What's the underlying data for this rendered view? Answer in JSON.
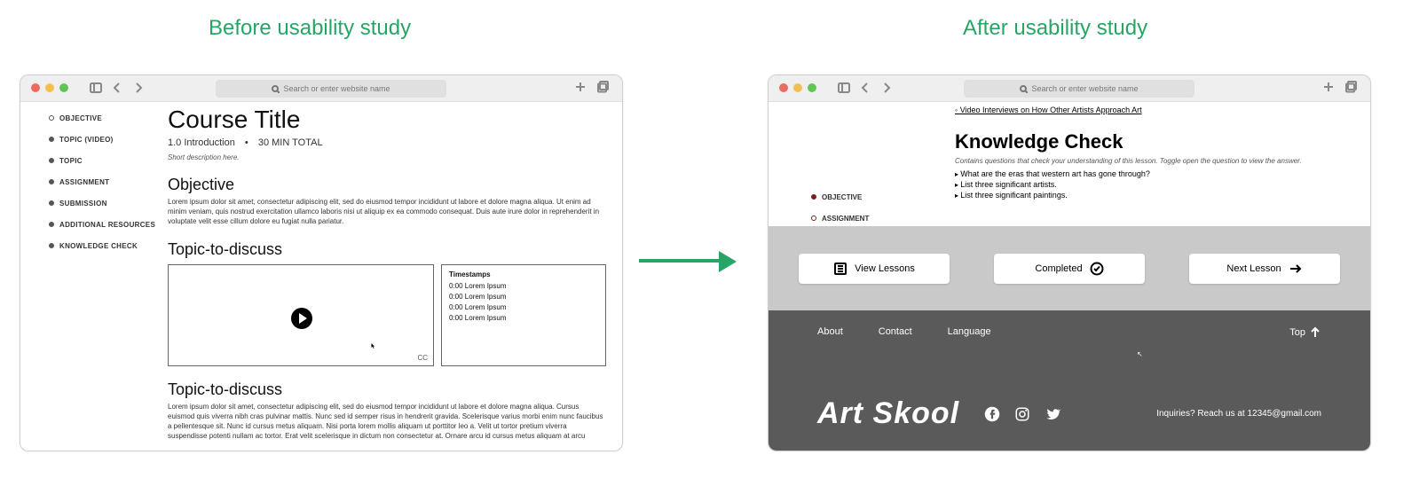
{
  "headings": {
    "before": "Before usability study",
    "after": "After usability study"
  },
  "chrome": {
    "url_placeholder": "Search or enter website name"
  },
  "left": {
    "nav": [
      "OBJECTIVE",
      "TOPIC (VIDEO)",
      "TOPIC",
      "ASSIGNMENT",
      "SUBMISSION",
      "ADDITIONAL RESOURCES",
      "KNOWLEDGE CHECK"
    ],
    "title": "Course Title",
    "meta_left": "1.0 Introduction",
    "meta_right": "30 MIN TOTAL",
    "short": "Short description here.",
    "objective_h": "Objective",
    "objective_p": "Lorem ipsum dolor sit amet, consectetur adipiscing elit, sed do eiusmod tempor incididunt ut labore et dolore magna aliqua. Ut enim ad minim veniam, quis nostrud exercitation ullamco laboris nisi ut aliquip ex ea commodo consequat. Duis aute irure dolor in reprehenderit in voluptate velit esse cillum dolore eu fugiat nulla pariatur.",
    "topic_h": "Topic-to-discuss",
    "cc": "CC",
    "ts_head": "Timestamps",
    "ts_rows": [
      "0:00   Lorem Ipsum",
      "0:00   Lorem Ipsum",
      "0:00   Lorem Ipsum",
      "0:00   Lorem Ipsum"
    ],
    "topic2_h": "Topic-to-discuss",
    "topic2_p": "Lorem ipsum dolor sit amet, consectetur adipiscing elit, sed do eiusmod tempor incididunt ut labore et dolore magna aliqua. Cursus euismod quis viverra nibh cras pulvinar mattis. Nunc sed id semper risus in hendrerit gravida. Scelerisque varius morbi enim nunc faucibus a pellentesque sit. Nunc id cursus metus aliquam. Nisi porta lorem mollis aliquam ut porttitor leo a. Velit ut tortor pretium viverra suspendisse potenti nullam ac tortor. Erat velit scelerisque in dictum non consectetur at. Ornare arcu id cursus metus aliquam at arcu"
  },
  "right": {
    "link": "Video Interviews on How Other Artists Approach Art",
    "kc_h": "Knowledge Check",
    "kc_desc": "Contains questions that check your understanding of this lesson. Toggle open the question to view the answer.",
    "questions": [
      "What are the eras that western art has gone through?",
      "List three significant artists.",
      "List three significant paintings."
    ],
    "nav": [
      "OBJECTIVE",
      "ASSIGNMENT"
    ],
    "buttons": {
      "view": "View Lessons",
      "completed": "Completed",
      "next": "Next Lesson"
    },
    "footer_nav": [
      "About",
      "Contact",
      "Language"
    ],
    "top": "Top",
    "brand": "Art Skool",
    "inquiries": "Inquiries? Reach us at 12345@gmail.com"
  }
}
